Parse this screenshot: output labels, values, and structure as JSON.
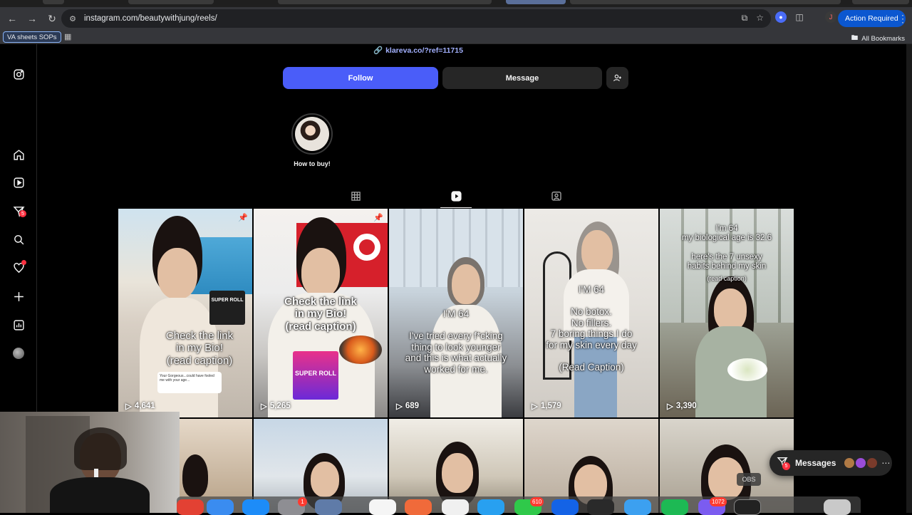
{
  "browser": {
    "url": "instagram.com/beautywithjung/reels/",
    "action_required": "Action Required",
    "profile_initial": "J",
    "bookmarks": {
      "chip": "VA sheets SOPs",
      "all": "All Bookmarks"
    }
  },
  "profile": {
    "bio_link": "klareva.co/?ref=11715",
    "follow": "Follow",
    "message": "Message",
    "highlight_label": "How to buy!"
  },
  "sidebar": {
    "notifications_badge": "5"
  },
  "reels": [
    {
      "caption": "Check the link\nin my Bio!\n(read caption)",
      "views": "4,641",
      "product": "SUPER ROLL",
      "overlay": "Your Gorgeous...could have fooled me with your age..."
    },
    {
      "caption": "Check the link\nin my Bio!\n(read caption)",
      "views": "5,265",
      "product": "SUPER ROLL"
    },
    {
      "caption": "I'M 64\n\nI've tried every f*cking\nthing to look younger\nand this is what actually\nworked for me.",
      "views": "689"
    },
    {
      "caption": "I'M 64\n\nNo botox.\nNo fillers.\n7 boring things I do\nfor my skin every day\n\n(Read Caption)",
      "views": "1,579"
    },
    {
      "caption": "I'm 64\nmy biological age is 32.6\n\nhere's the 7 unsexy\nhabits behind my skin",
      "caption2": "(read caption)",
      "views": "3,390"
    }
  ],
  "messages": {
    "label": "Messages",
    "badge": "5"
  },
  "obs": "OBS",
  "dock": {
    "badge1": "1",
    "badge2": "610",
    "badge3": "1072"
  },
  "colors": {
    "accent": "#4a5df9",
    "badge": "#ff3040",
    "chrome_action": "#0b57d0"
  }
}
